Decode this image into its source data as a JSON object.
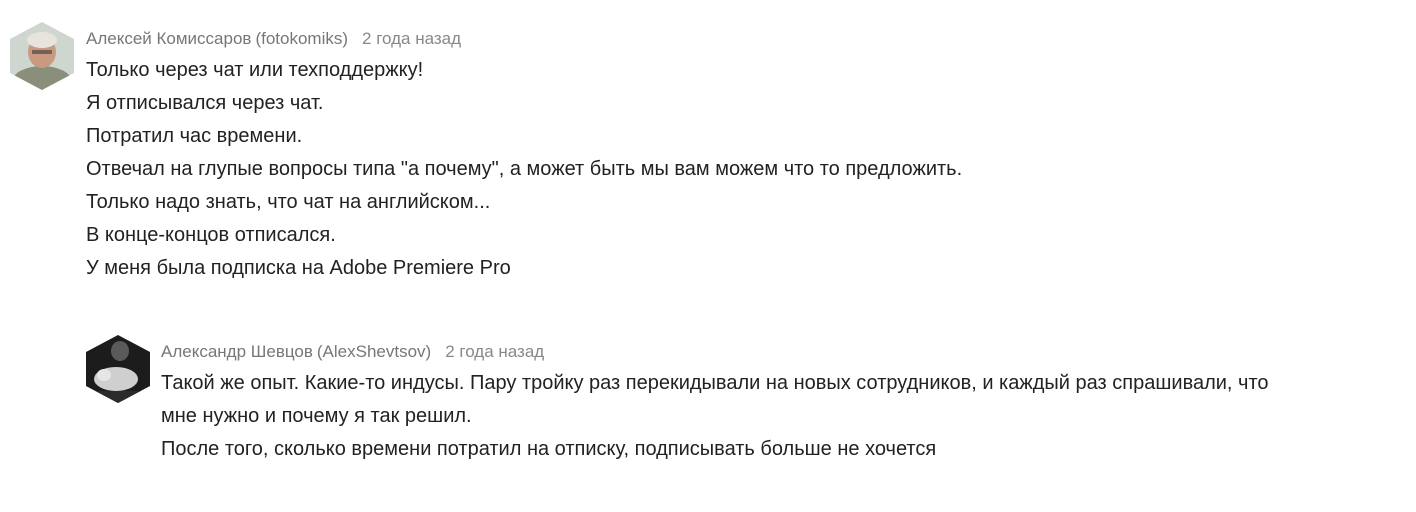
{
  "comments": [
    {
      "author": "Алексей  Комиссаров",
      "nick": "(fotokomiks)",
      "time": "2 года назад",
      "lines": [
        "Только через чат или техподдержку!",
        "Я отписывался через чат.",
        "Потратил час времени.",
        "Отвечал на глупые вопросы типа \"а почему\", а может быть мы вам можем что то предложить.",
        "Только надо знать, что чат на английском...",
        "В конце-концов отписался.",
        "У меня была подписка на Adobe Premiere Pro"
      ]
    },
    {
      "author": "Александр  Шевцов",
      "nick": "(AlexShevtsov)",
      "time": "2 года назад",
      "lines": [
        "Такой же опыт. Какие-то индусы. Пару тройку раз перекидывали на новых сотрудников, и каждый раз спрашивали, что",
        "мне нужно и почему я так решил.",
        "После того, сколько времени потратил на отписку, подписывать больше не хочется"
      ]
    }
  ]
}
